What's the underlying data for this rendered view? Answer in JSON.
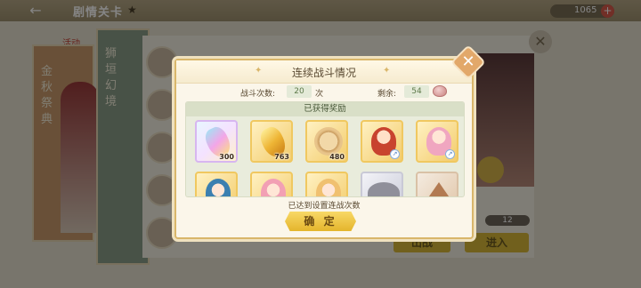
{
  "topbar": {
    "title": "剧情关卡",
    "currency_value": "1065"
  },
  "background": {
    "event_label": "活动",
    "event_card_title": "金秋祭典",
    "panel_title": "狮垣幻境",
    "counter_value": "12",
    "buttons": [
      "出战",
      "进入"
    ]
  },
  "modal": {
    "title": "连续战斗情况",
    "battle_count_label": "战斗次数:",
    "battle_count_value": "20",
    "battle_count_unit": "次",
    "remaining_label": "剩余:",
    "remaining_value": "54",
    "rewards_header": "已获得奖励",
    "rewards": [
      {
        "icon": "rainbow-crystal-icon",
        "count": "300"
      },
      {
        "icon": "gold-crystal-icon",
        "count": "763"
      },
      {
        "icon": "coin-icon",
        "count": "480"
      },
      {
        "icon": "character-card-icon",
        "count": ""
      },
      {
        "icon": "character-card-icon",
        "count": ""
      },
      {
        "icon": "character-card-icon",
        "count": ""
      },
      {
        "icon": "character-card-icon",
        "count": ""
      },
      {
        "icon": "character-card-icon",
        "count": ""
      },
      {
        "icon": "fan-item-icon",
        "count": ""
      },
      {
        "icon": "hat-item-icon",
        "count": ""
      }
    ],
    "status_message": "已达到设置连战次数",
    "confirm_label": "确 定"
  }
}
